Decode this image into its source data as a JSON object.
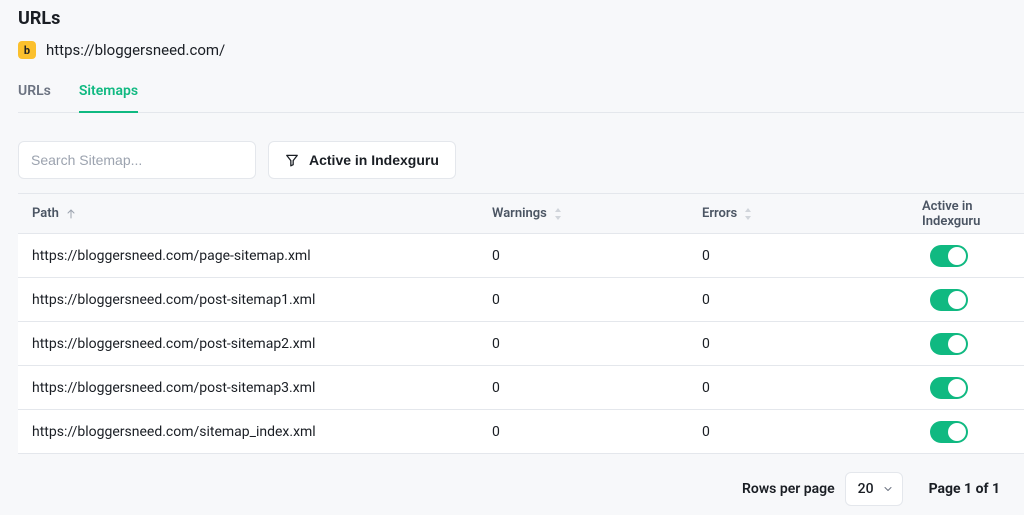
{
  "header": {
    "title": "URLs",
    "site_url": "https://bloggersneed.com/",
    "site_badge_letter": "b"
  },
  "tabs": [
    {
      "label": "URLs",
      "active": false
    },
    {
      "label": "Sitemaps",
      "active": true
    }
  ],
  "controls": {
    "search_placeholder": "Search Sitemap...",
    "filter_label": "Active in Indexguru"
  },
  "table": {
    "columns": {
      "path": "Path",
      "warnings": "Warnings",
      "errors": "Errors",
      "active": "Active in Indexguru"
    },
    "rows": [
      {
        "path": "https://bloggersneed.com/page-sitemap.xml",
        "warnings": 0,
        "errors": 0,
        "active": true
      },
      {
        "path": "https://bloggersneed.com/post-sitemap1.xml",
        "warnings": 0,
        "errors": 0,
        "active": true
      },
      {
        "path": "https://bloggersneed.com/post-sitemap2.xml",
        "warnings": 0,
        "errors": 0,
        "active": true
      },
      {
        "path": "https://bloggersneed.com/post-sitemap3.xml",
        "warnings": 0,
        "errors": 0,
        "active": true
      },
      {
        "path": "https://bloggersneed.com/sitemap_index.xml",
        "warnings": 0,
        "errors": 0,
        "active": true
      }
    ]
  },
  "footer": {
    "rows_per_page_label": "Rows per page",
    "rows_per_page_value": "20",
    "page_info": "Page 1 of 1"
  }
}
